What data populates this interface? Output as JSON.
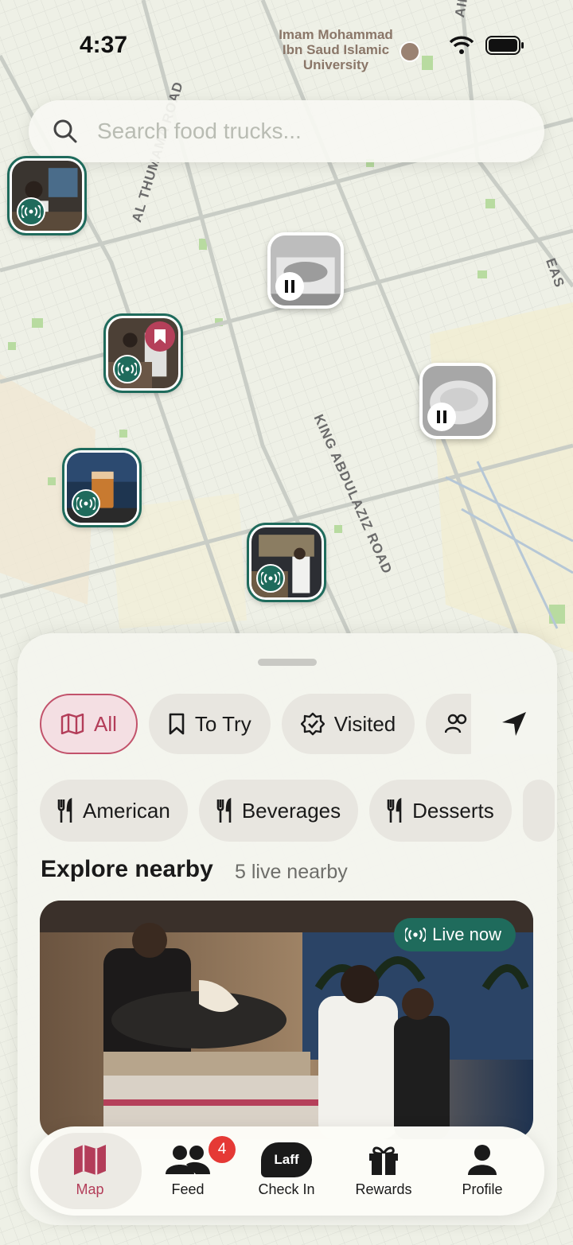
{
  "status_bar": {
    "time": "4:37"
  },
  "map": {
    "poi_label": "Imam Mohammad Ibn Saud Islamic University",
    "road_labels": {
      "airport": "AIRPORT",
      "al_thumama": "AL THUMAMA ROAD",
      "king_abdulaziz": "KING ABDULAZIZ ROAD",
      "east": "EAS"
    },
    "pins": [
      {
        "status": "live",
        "bookmarked": false,
        "icon": "broadcast-icon"
      },
      {
        "status": "paused",
        "bookmarked": false,
        "icon": "pause-icon"
      },
      {
        "status": "live",
        "bookmarked": true,
        "icon": "broadcast-icon"
      },
      {
        "status": "paused",
        "bookmarked": false,
        "icon": "pause-icon"
      },
      {
        "status": "live",
        "bookmarked": false,
        "icon": "broadcast-icon"
      },
      {
        "status": "live",
        "bookmarked": false,
        "icon": "broadcast-icon"
      }
    ]
  },
  "search": {
    "placeholder": "Search food trucks..."
  },
  "filters": [
    {
      "label": "All",
      "icon": "map-icon",
      "active": true
    },
    {
      "label": "To Try",
      "icon": "bookmark-icon",
      "active": false
    },
    {
      "label": "Visited",
      "icon": "verified-badge-icon",
      "active": false
    },
    {
      "label": "",
      "icon": "people-icon",
      "active": false
    }
  ],
  "categories": [
    {
      "label": "American",
      "icon": "utensils-icon"
    },
    {
      "label": "Beverages",
      "icon": "utensils-icon"
    },
    {
      "label": "Desserts",
      "icon": "utensils-icon"
    }
  ],
  "explore": {
    "title": "Explore nearby",
    "subtitle": "5 live nearby",
    "card": {
      "badge": "Live now"
    }
  },
  "tabs": [
    {
      "label": "Map",
      "icon": "map-icon",
      "active": true
    },
    {
      "label": "Feed",
      "icon": "people-icon",
      "badge": "4"
    },
    {
      "label": "Check In",
      "icon": "laff-icon",
      "logo_text": "Laff"
    },
    {
      "label": "Rewards",
      "icon": "gift-icon"
    },
    {
      "label": "Profile",
      "icon": "person-icon"
    }
  ],
  "colors": {
    "accent": "#b33d59",
    "live": "#1f6b5c",
    "notification": "#e53935"
  }
}
